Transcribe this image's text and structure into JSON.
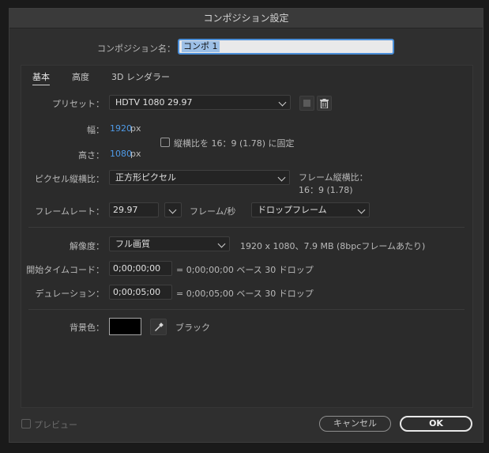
{
  "dialog": {
    "title": "コンポジション設定"
  },
  "name": {
    "label": "コンポジション名：",
    "value": "コンポ 1"
  },
  "tabs": [
    {
      "label": "基本",
      "active": true
    },
    {
      "label": "高度",
      "active": false
    },
    {
      "label": "3D レンダラー",
      "active": false
    }
  ],
  "preset": {
    "label": "プリセット：",
    "value": "HDTV 1080 29.97"
  },
  "size": {
    "width_label": "幅：",
    "width_value": "1920",
    "width_unit": "px",
    "height_label": "高さ：",
    "height_value": "1080",
    "height_unit": "px",
    "lock_label": "縦横比を 16：9 (1.78) に固定"
  },
  "pixel_aspect": {
    "label": "ピクセル縦横比：",
    "value": "正方形ピクセル",
    "frame_aspect_label": "フレーム縦横比：",
    "frame_aspect_value": "16：9 (1.78)"
  },
  "frame_rate": {
    "label": "フレームレート：",
    "value": "29.97",
    "unit": "フレーム/秒",
    "drop_value": "ドロップフレーム"
  },
  "resolution": {
    "label": "解像度：",
    "value": "フル画質",
    "info": "1920 x 1080、7.9 MB (8bpcフレームあたり)"
  },
  "start_timecode": {
    "label": "開始タイムコード：",
    "value": "0;00;00;00",
    "info": "= 0;00;00;00  ベース 30  ドロップ"
  },
  "duration": {
    "label": "デュレーション：",
    "value": "0;00;05;00",
    "info": "= 0;00;05;00  ベース 30  ドロップ"
  },
  "background": {
    "label": "背景色：",
    "color_name": "ブラック",
    "color": "#000000"
  },
  "footer": {
    "preview_label": "プレビュー",
    "cancel_label": "キャンセル",
    "ok_label": "OK"
  },
  "colors": {
    "accent": "#4f9be8",
    "background": "#2f2f2f"
  }
}
